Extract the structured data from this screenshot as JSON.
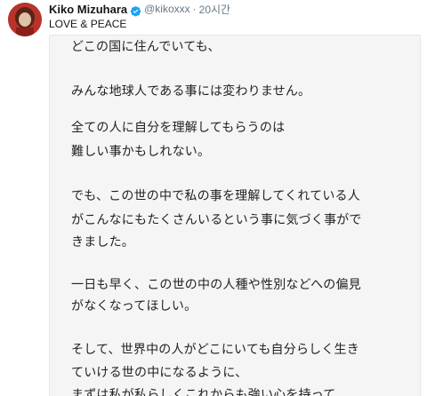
{
  "tweet": {
    "author_name": "Kiko Mizuhara",
    "handle": "@kikoxxx",
    "separator": "·",
    "time": "20시간",
    "bio_text": "LOVE & PEACE",
    "verified_icon": "verified-badge-icon",
    "accent_color": "#1da1f2",
    "note_lines": [
      "どこの国に住んでいても、",
      "みんな地球人である事には変わりません。",
      "全ての人に自分を理解してもらうのは",
      "難しい事かもしれない。",
      "でも、この世の中で私の事を理解してくれている人",
      "がこんなにもたくさんいるという事に気づく事がで",
      "きました。",
      "一日も早く、この世の中の人種や性別などへの偏見",
      "がなくなってほしい。",
      "そして、世界中の人がどこにいても自分らしく生き",
      "ていける世の中になるように、",
      "まずは私が私らしくこれからも強い心を持って、"
    ]
  }
}
